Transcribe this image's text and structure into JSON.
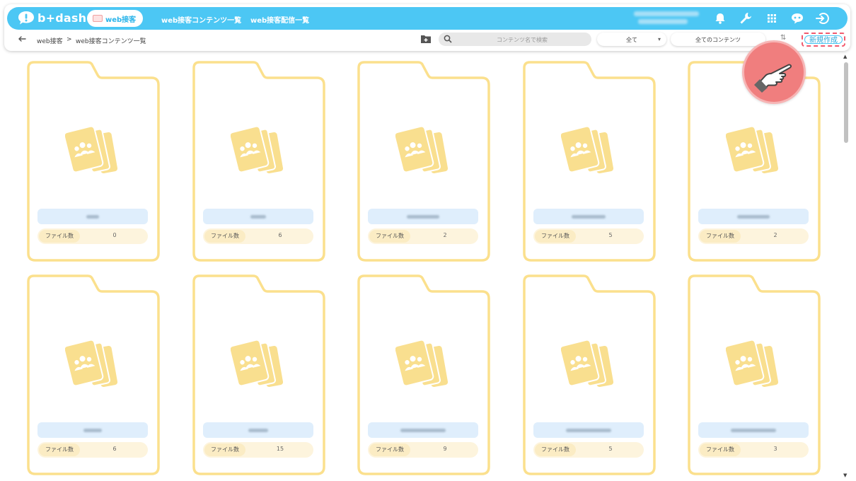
{
  "app": {
    "brand": "b+dash"
  },
  "nav": {
    "active_label": "web接客",
    "links": [
      "web接客コンテンツ一覧",
      "web接客配信一覧"
    ]
  },
  "icons": [
    "bell-icon",
    "wrench-icon",
    "grid-icon",
    "chat-bot-icon",
    "logout-icon"
  ],
  "breadcrumb": {
    "root": "web接客",
    "separator": ">",
    "current": "web接客コンテンツ一覧"
  },
  "toolbar": {
    "search_placeholder": "コンテンツ名で検索",
    "filter_select": "全て",
    "content_select": "全てのコンテンツ",
    "new_button": "新規作成"
  },
  "folders": [
    {
      "label": "ファイル数",
      "count": "0"
    },
    {
      "label": "ファイル数",
      "count": "6"
    },
    {
      "label": "ファイル数",
      "count": "2"
    },
    {
      "label": "ファイル数",
      "count": "5"
    },
    {
      "label": "ファイル数",
      "count": "2"
    },
    {
      "label": "ファイル数",
      "count": "6"
    },
    {
      "label": "ファイル数",
      "count": "15"
    },
    {
      "label": "ファイル数",
      "count": "9"
    },
    {
      "label": "ファイル数",
      "count": "5"
    },
    {
      "label": "ファイル数",
      "count": "3"
    }
  ],
  "colors": {
    "topbar": "#4cc7f4",
    "folder_border": "#fbe08d",
    "folder_icon": "#f9df8f",
    "name_pill": "#dfeefc",
    "stat_pill": "#fdf4dd",
    "highlight": "#f15a6e"
  }
}
